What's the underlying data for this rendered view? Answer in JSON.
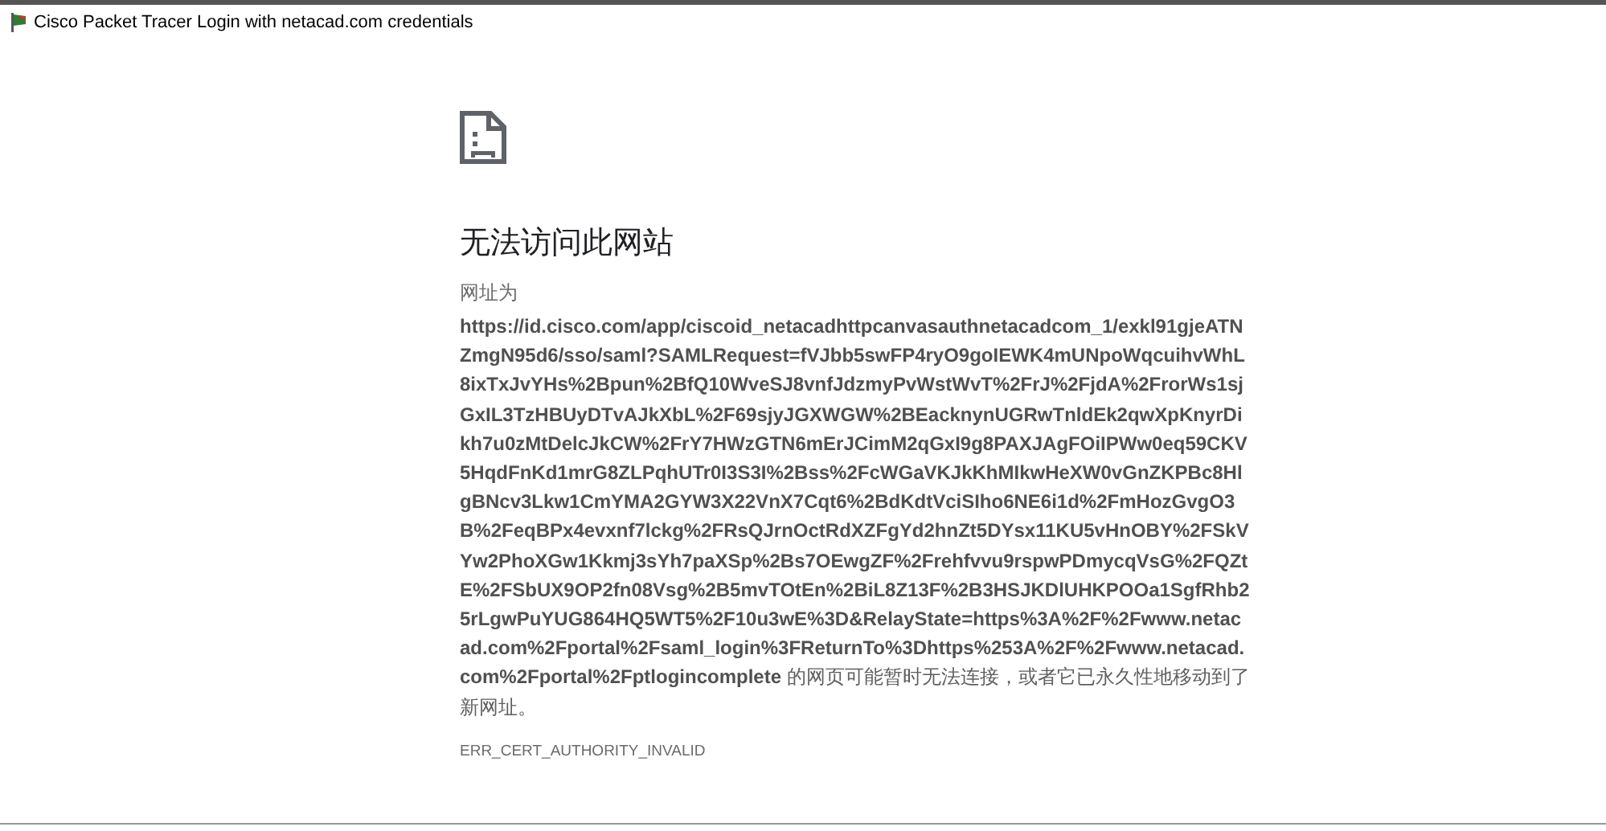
{
  "window": {
    "title": "Cisco Packet Tracer Login with netacad.com credentials"
  },
  "error": {
    "heading": "无法访问此网站",
    "label": "网址为",
    "message": "**https://id.cisco.com/app/ciscoid_netacadhttpcanvasauthnetacadcom_1/exkl91gjeATNZmgN95d6/sso/saml?SAMLRequest=fVJbb5swFP4ryO9goIEWK4mUNpoWqcuihvWhL8ixTxJvYHs%2Bpun%2BfQ10WveSJ8vnfJdzmyPvWstWvT%2FrJ%2FjdA%2FrorWs1sjGxIL3TzHBUyDTvAJkXbL%2F69sjyJGXWGW%2BEacknynUGRwTnldEk2qwXpKnyrDikh7u0zMtDelcJkCW%2FrY7HWzGTN6mErJCimM2qGxI9g8PAXJAgFOiIPWw0eq59CKV5HqdFnKd1mrG8ZLPqhUTr0I3S3I%2Bss%2FcWGaVKJkKhMIkwHeXW0vGnZKPBc8HlgBNcv3Lkw1CmYMA2GYW3X22VnX7Cqt6%2BdKdtVciSIho6NE6i1d%2FmHozGvgO3B%2FeqBPx4evxnf7lckg%2FRsQJrnOctRdXZFgYd2hnZt5DYsx11KU5vHnOBY%2FSkVYw2PhoXGw1Kkmj3sYh7paXSp%2Bs7OEwgZF%2Frehfvvu9rspwPDmycqVsG%2FQZtE%2FSbUX9OP2fn08Vsg%2B5mvTOtEn%2BiL8Z13F%2B3HSJKDlUHKPOOa1SgfRhb25rLgwPuYUG864HQ5WT5%2F10u3wE%3D&RelayState=https%3A%2F%2Fwww.netacad.com%2Fportal%2Fsaml_login%3FReturnTo%3Dhttps%253A%2F%2Fwww.netacad.com%2Fportal%2Fptlogincomplete** 的网页可能暂时无法连接，或者它已永久性地移动到了新网址。",
    "code": "ERR_CERT_AUTHORITY_INVALID"
  }
}
